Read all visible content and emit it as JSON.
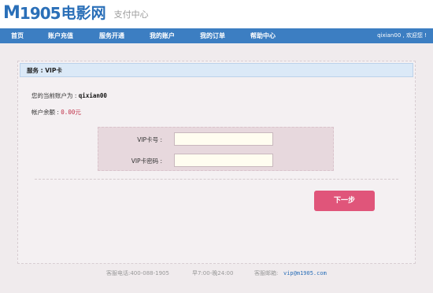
{
  "header": {
    "logo_m": "M",
    "logo_num": "1905",
    "logo_cn": "电影网",
    "subtitle": "支付中心"
  },
  "nav": {
    "items": [
      "首页",
      "账户充值",
      "服务开通",
      "我的账户",
      "我的订单",
      "帮助中心"
    ],
    "user_greeting": "qixian00 , 欢迎您 !"
  },
  "panel": {
    "title": "服务 : VIP卡",
    "account_label": "您的当前账户为 : ",
    "account_value": "qixian00",
    "balance_label": "帐户余额 : ",
    "balance_value": "0.00元"
  },
  "form": {
    "card_number_label": "VIP卡号 :",
    "card_number_value": "",
    "card_password_label": "VIP卡密码 :",
    "card_password_value": ""
  },
  "actions": {
    "next_label": "下一步"
  },
  "footer": {
    "phone": "客服电话:400-088-1905",
    "hours": "早7:00-晚24:00",
    "email_label": "客服邮箱:",
    "email_value": "vip@m1905.com"
  },
  "colors": {
    "nav_bg": "#3c7ec2",
    "brand_blue": "#2a6fb8",
    "button_pink": "#e0557a",
    "balance_red": "#c0324a"
  }
}
